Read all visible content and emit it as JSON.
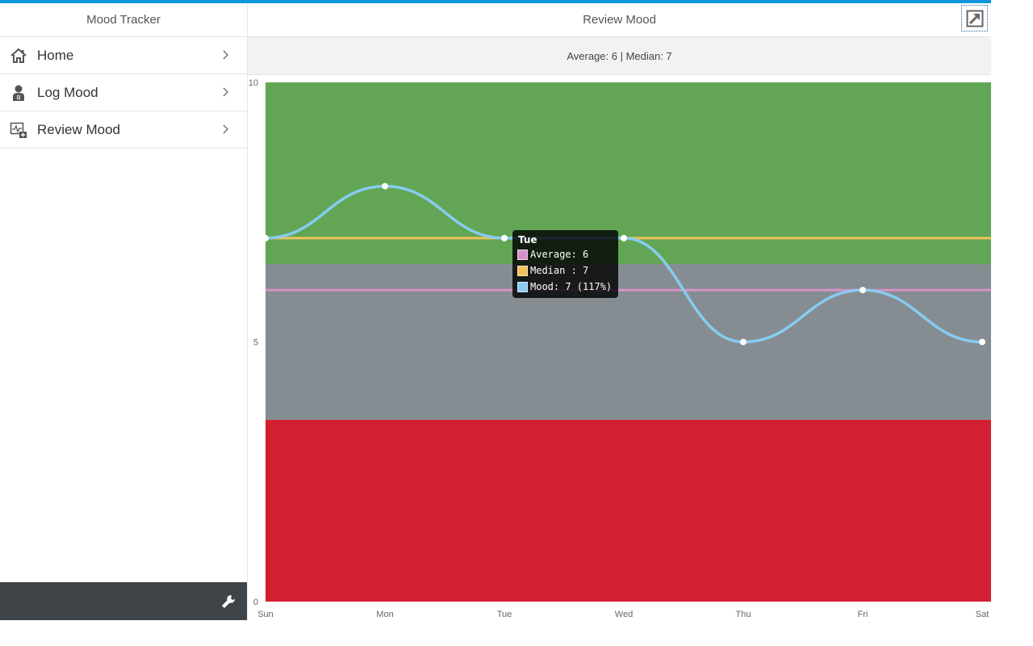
{
  "master": {
    "title": "Mood Tracker",
    "nav": [
      {
        "label": "Home",
        "icon": "home-icon"
      },
      {
        "label": "Log Mood",
        "icon": "person-icon"
      },
      {
        "label": "Review Mood",
        "icon": "chart-add-icon"
      }
    ],
    "footer_icon": "wrench-icon"
  },
  "detail": {
    "title": "Review Mood",
    "fullscreen_icon": "expand-icon",
    "summary": "Average: 6 | Median: 7"
  },
  "colors": {
    "accent": "#0f95db",
    "band_good": "#62a655",
    "band_neutral": "#858d92",
    "band_bad": "#d21f31",
    "mood_line": "#88cbf0",
    "average_line": "#d692c8",
    "median_line": "#f2c25a"
  },
  "chart_data": {
    "type": "line",
    "categories": [
      "Sun",
      "Mon",
      "Tue",
      "Wed",
      "Thu",
      "Fri",
      "Sat"
    ],
    "series": [
      {
        "name": "Mood",
        "values": [
          7,
          8,
          7,
          7,
          5,
          6,
          5
        ]
      },
      {
        "name": "Average",
        "values": [
          6,
          6,
          6,
          6,
          6,
          6,
          6
        ]
      },
      {
        "name": "Median",
        "values": [
          7,
          7,
          7,
          7,
          7,
          7,
          7
        ]
      }
    ],
    "bands": [
      {
        "from": 6.5,
        "to": 10
      },
      {
        "from": 3.5,
        "to": 6.5
      },
      {
        "from": 0,
        "to": 3.5
      }
    ],
    "ylim": [
      0,
      10
    ],
    "y_ticks": [
      "0",
      "5",
      "10"
    ],
    "tooltip": {
      "title": "Tue",
      "rows": [
        "Average: 6",
        "Median : 7",
        "Mood: 7 (117%)"
      ]
    }
  }
}
